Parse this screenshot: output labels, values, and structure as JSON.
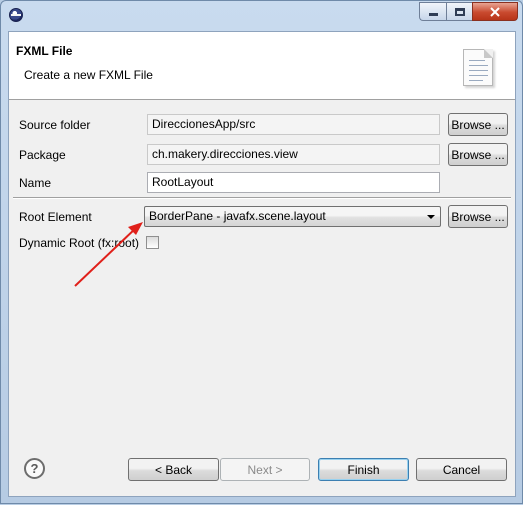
{
  "window": {
    "controls": {
      "minimize": "minimize-icon",
      "maximize": "maximize-icon",
      "close": "close-icon"
    }
  },
  "banner": {
    "title": "FXML File",
    "description": "Create a new FXML File",
    "icon": "document-icon"
  },
  "form": {
    "source_folder": {
      "label": "Source folder",
      "value": "DireccionesApp/src",
      "button": "Browse ..."
    },
    "package": {
      "label": "Package",
      "value": "ch.makery.direcciones.view",
      "button": "Browse ..."
    },
    "name": {
      "label": "Name",
      "value": "RootLayout"
    },
    "root_element": {
      "label": "Root Element",
      "value": "BorderPane - javafx.scene.layout",
      "button": "Browse ..."
    },
    "dynamic_root": {
      "label": "Dynamic Root (fx:root)",
      "checked": false
    }
  },
  "annotation": {
    "color": "#e0201a"
  },
  "footer": {
    "back": "< Back",
    "next": "Next >",
    "finish": "Finish",
    "cancel": "Cancel",
    "help_glyph": "?"
  }
}
